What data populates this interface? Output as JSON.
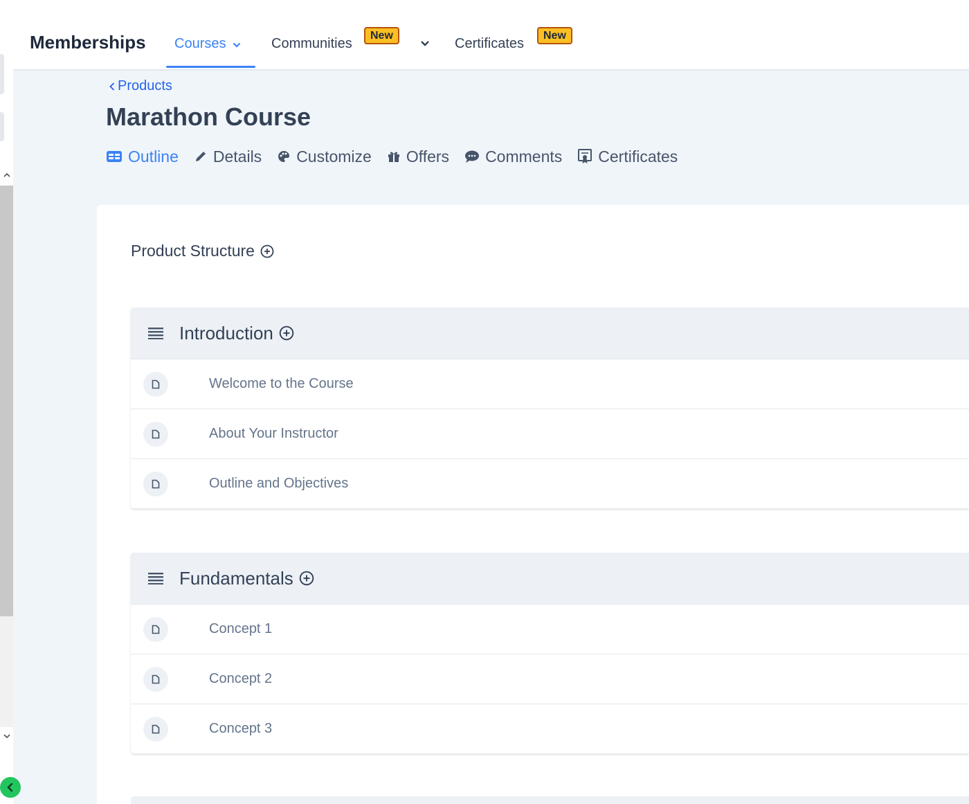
{
  "app": {
    "title": "Memberships"
  },
  "nav": {
    "items": [
      {
        "label": "Courses",
        "active": true,
        "has_dropdown": true,
        "badge": ""
      },
      {
        "label": "Communities",
        "active": false,
        "has_dropdown": true,
        "badge": "New"
      },
      {
        "label": "Certificates",
        "active": false,
        "has_dropdown": false,
        "badge": "New"
      }
    ]
  },
  "breadcrumb": {
    "label": "Products"
  },
  "page": {
    "title": "Marathon Course"
  },
  "tabs": [
    {
      "label": "Outline",
      "icon": "outline-icon",
      "active": true
    },
    {
      "label": "Details",
      "icon": "pencil-icon",
      "active": false
    },
    {
      "label": "Customize",
      "icon": "palette-icon",
      "active": false
    },
    {
      "label": "Offers",
      "icon": "gift-icon",
      "active": false
    },
    {
      "label": "Comments",
      "icon": "comment-icon",
      "active": false
    },
    {
      "label": "Certificates",
      "icon": "certificate-icon",
      "active": false
    }
  ],
  "structure": {
    "title": "Product Structure",
    "sections": [
      {
        "name": "Introduction",
        "lessons": [
          "Welcome to the Course",
          "About Your Instructor",
          "Outline and Objectives"
        ]
      },
      {
        "name": "Fundamentals",
        "lessons": [
          "Concept 1",
          "Concept 2",
          "Concept 3"
        ]
      }
    ]
  },
  "colors": {
    "accent": "#3b82f6",
    "badge": "#fbbf24",
    "background": "#f0f5fa",
    "collapse_button": "#22c55e"
  }
}
